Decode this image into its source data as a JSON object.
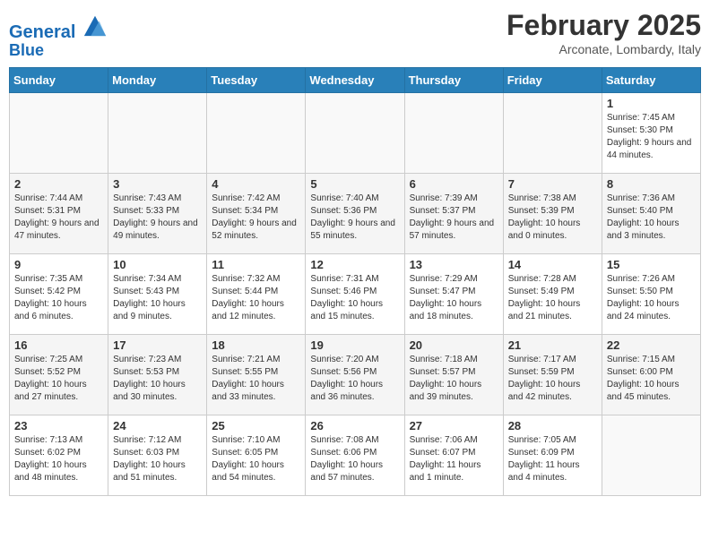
{
  "header": {
    "logo_line1": "General",
    "logo_line2": "Blue",
    "month": "February 2025",
    "location": "Arconate, Lombardy, Italy"
  },
  "weekdays": [
    "Sunday",
    "Monday",
    "Tuesday",
    "Wednesday",
    "Thursday",
    "Friday",
    "Saturday"
  ],
  "weeks": [
    [
      {
        "day": "",
        "info": ""
      },
      {
        "day": "",
        "info": ""
      },
      {
        "day": "",
        "info": ""
      },
      {
        "day": "",
        "info": ""
      },
      {
        "day": "",
        "info": ""
      },
      {
        "day": "",
        "info": ""
      },
      {
        "day": "1",
        "info": "Sunrise: 7:45 AM\nSunset: 5:30 PM\nDaylight: 9 hours and 44 minutes."
      }
    ],
    [
      {
        "day": "2",
        "info": "Sunrise: 7:44 AM\nSunset: 5:31 PM\nDaylight: 9 hours and 47 minutes."
      },
      {
        "day": "3",
        "info": "Sunrise: 7:43 AM\nSunset: 5:33 PM\nDaylight: 9 hours and 49 minutes."
      },
      {
        "day": "4",
        "info": "Sunrise: 7:42 AM\nSunset: 5:34 PM\nDaylight: 9 hours and 52 minutes."
      },
      {
        "day": "5",
        "info": "Sunrise: 7:40 AM\nSunset: 5:36 PM\nDaylight: 9 hours and 55 minutes."
      },
      {
        "day": "6",
        "info": "Sunrise: 7:39 AM\nSunset: 5:37 PM\nDaylight: 9 hours and 57 minutes."
      },
      {
        "day": "7",
        "info": "Sunrise: 7:38 AM\nSunset: 5:39 PM\nDaylight: 10 hours and 0 minutes."
      },
      {
        "day": "8",
        "info": "Sunrise: 7:36 AM\nSunset: 5:40 PM\nDaylight: 10 hours and 3 minutes."
      }
    ],
    [
      {
        "day": "9",
        "info": "Sunrise: 7:35 AM\nSunset: 5:42 PM\nDaylight: 10 hours and 6 minutes."
      },
      {
        "day": "10",
        "info": "Sunrise: 7:34 AM\nSunset: 5:43 PM\nDaylight: 10 hours and 9 minutes."
      },
      {
        "day": "11",
        "info": "Sunrise: 7:32 AM\nSunset: 5:44 PM\nDaylight: 10 hours and 12 minutes."
      },
      {
        "day": "12",
        "info": "Sunrise: 7:31 AM\nSunset: 5:46 PM\nDaylight: 10 hours and 15 minutes."
      },
      {
        "day": "13",
        "info": "Sunrise: 7:29 AM\nSunset: 5:47 PM\nDaylight: 10 hours and 18 minutes."
      },
      {
        "day": "14",
        "info": "Sunrise: 7:28 AM\nSunset: 5:49 PM\nDaylight: 10 hours and 21 minutes."
      },
      {
        "day": "15",
        "info": "Sunrise: 7:26 AM\nSunset: 5:50 PM\nDaylight: 10 hours and 24 minutes."
      }
    ],
    [
      {
        "day": "16",
        "info": "Sunrise: 7:25 AM\nSunset: 5:52 PM\nDaylight: 10 hours and 27 minutes."
      },
      {
        "day": "17",
        "info": "Sunrise: 7:23 AM\nSunset: 5:53 PM\nDaylight: 10 hours and 30 minutes."
      },
      {
        "day": "18",
        "info": "Sunrise: 7:21 AM\nSunset: 5:55 PM\nDaylight: 10 hours and 33 minutes."
      },
      {
        "day": "19",
        "info": "Sunrise: 7:20 AM\nSunset: 5:56 PM\nDaylight: 10 hours and 36 minutes."
      },
      {
        "day": "20",
        "info": "Sunrise: 7:18 AM\nSunset: 5:57 PM\nDaylight: 10 hours and 39 minutes."
      },
      {
        "day": "21",
        "info": "Sunrise: 7:17 AM\nSunset: 5:59 PM\nDaylight: 10 hours and 42 minutes."
      },
      {
        "day": "22",
        "info": "Sunrise: 7:15 AM\nSunset: 6:00 PM\nDaylight: 10 hours and 45 minutes."
      }
    ],
    [
      {
        "day": "23",
        "info": "Sunrise: 7:13 AM\nSunset: 6:02 PM\nDaylight: 10 hours and 48 minutes."
      },
      {
        "day": "24",
        "info": "Sunrise: 7:12 AM\nSunset: 6:03 PM\nDaylight: 10 hours and 51 minutes."
      },
      {
        "day": "25",
        "info": "Sunrise: 7:10 AM\nSunset: 6:05 PM\nDaylight: 10 hours and 54 minutes."
      },
      {
        "day": "26",
        "info": "Sunrise: 7:08 AM\nSunset: 6:06 PM\nDaylight: 10 hours and 57 minutes."
      },
      {
        "day": "27",
        "info": "Sunrise: 7:06 AM\nSunset: 6:07 PM\nDaylight: 11 hours and 1 minute."
      },
      {
        "day": "28",
        "info": "Sunrise: 7:05 AM\nSunset: 6:09 PM\nDaylight: 11 hours and 4 minutes."
      },
      {
        "day": "",
        "info": ""
      }
    ]
  ]
}
